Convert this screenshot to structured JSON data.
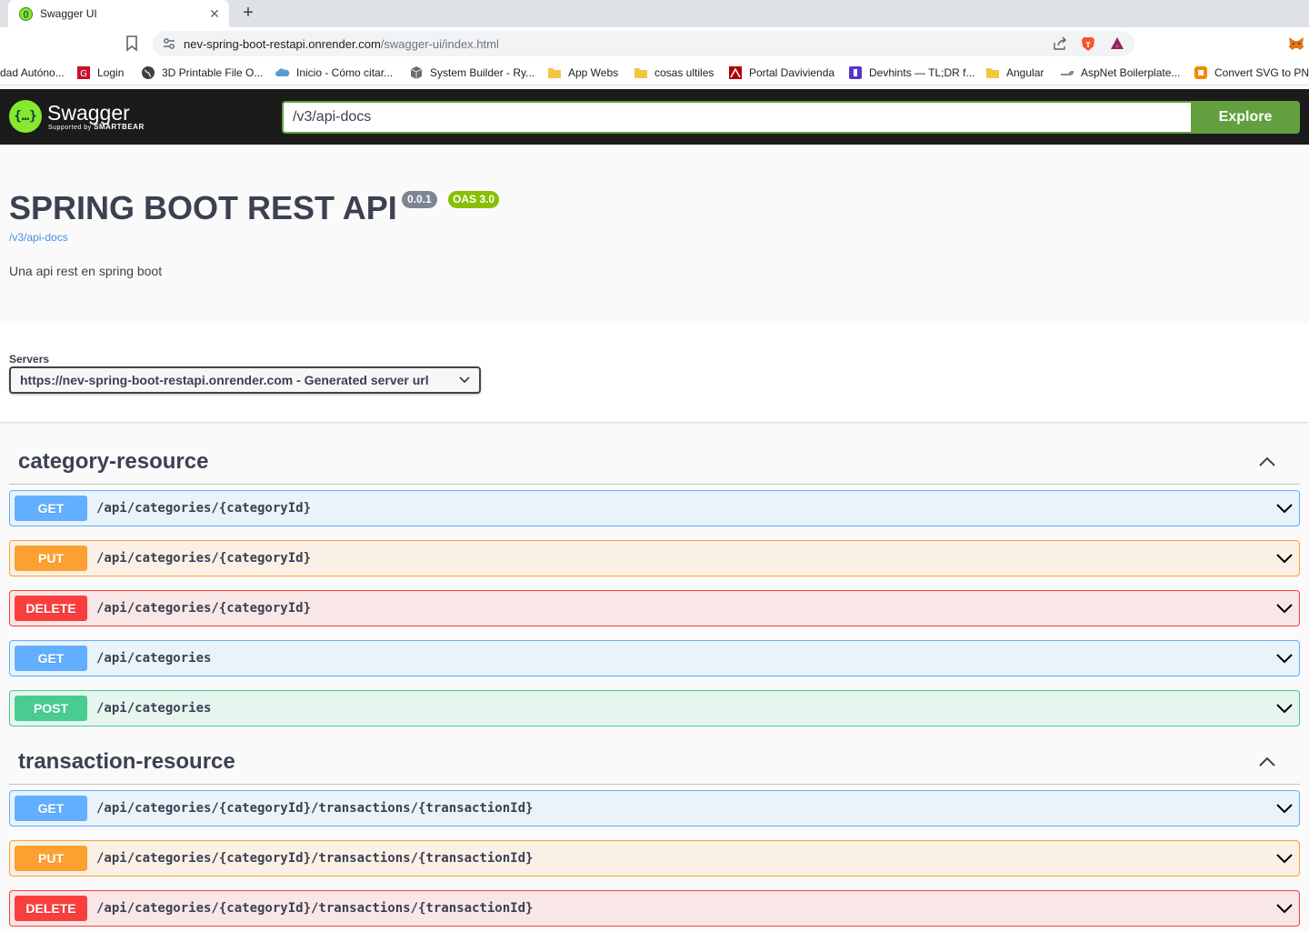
{
  "browser": {
    "tab_title": "Swagger UI",
    "url_host": "nev-spring-boot-restapi.onrender.com",
    "url_path": "/swagger-ui/index.html",
    "bookmarks": [
      "dad Autóno...",
      "Login",
      "3D Printable File O...",
      "Inicio - Cómo citar...",
      "System Builder - Ry...",
      "App Webs",
      "cosas ultiles",
      "Portal Davivienda",
      "Devhints — TL;DR f...",
      "Angular",
      "AspNet Boilerplate...",
      "Convert SVG to PN..."
    ]
  },
  "topbar": {
    "logo_name": "Swagger",
    "logo_sub_prefix": "Supported by",
    "logo_sub_brand": "SMARTBEAR",
    "spec_url": "/v3/api-docs",
    "explore_label": "Explore"
  },
  "info": {
    "title": "SPRING BOOT REST API",
    "version": "0.0.1",
    "oas": "OAS 3.0",
    "spec_link": "/v3/api-docs",
    "description": "Una api rest en spring boot"
  },
  "servers": {
    "label": "Servers",
    "selected": "https://nev-spring-boot-restapi.onrender.com - Generated server url"
  },
  "tags": [
    {
      "name": "category-resource",
      "operations": [
        {
          "method": "GET",
          "path": "/api/categories/{categoryId}"
        },
        {
          "method": "PUT",
          "path": "/api/categories/{categoryId}"
        },
        {
          "method": "DELETE",
          "path": "/api/categories/{categoryId}"
        },
        {
          "method": "GET",
          "path": "/api/categories"
        },
        {
          "method": "POST",
          "path": "/api/categories"
        }
      ]
    },
    {
      "name": "transaction-resource",
      "operations": [
        {
          "method": "GET",
          "path": "/api/categories/{categoryId}/transactions/{transactionId}"
        },
        {
          "method": "PUT",
          "path": "/api/categories/{categoryId}/transactions/{transactionId}"
        },
        {
          "method": "DELETE",
          "path": "/api/categories/{categoryId}/transactions/{transactionId}"
        }
      ]
    }
  ],
  "colors": {
    "get": "#61affe",
    "put": "#fca130",
    "delete": "#f93e3e",
    "post": "#49cc90",
    "swagger_green": "#85ea2d",
    "explore_green": "#62a03f"
  }
}
